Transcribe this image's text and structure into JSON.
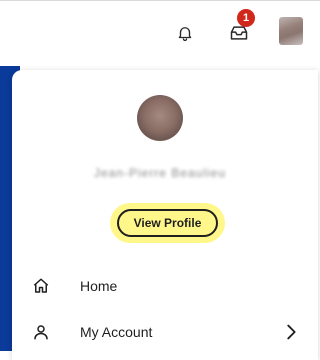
{
  "topbar": {
    "notifications_icon": "bell-icon",
    "inbox_icon": "inbox-icon",
    "inbox_badge": "1"
  },
  "profile": {
    "name": "Jean-Pierre Beaulieu",
    "view_profile_label": "View Profile"
  },
  "menu": {
    "items": [
      {
        "label": "Home",
        "icon": "home-icon"
      },
      {
        "label": "My Account",
        "icon": "user-icon"
      }
    ]
  },
  "colors": {
    "header_blue": "#0a3a9a",
    "badge_red": "#d0281a",
    "highlight_yellow": "#fff78a"
  }
}
